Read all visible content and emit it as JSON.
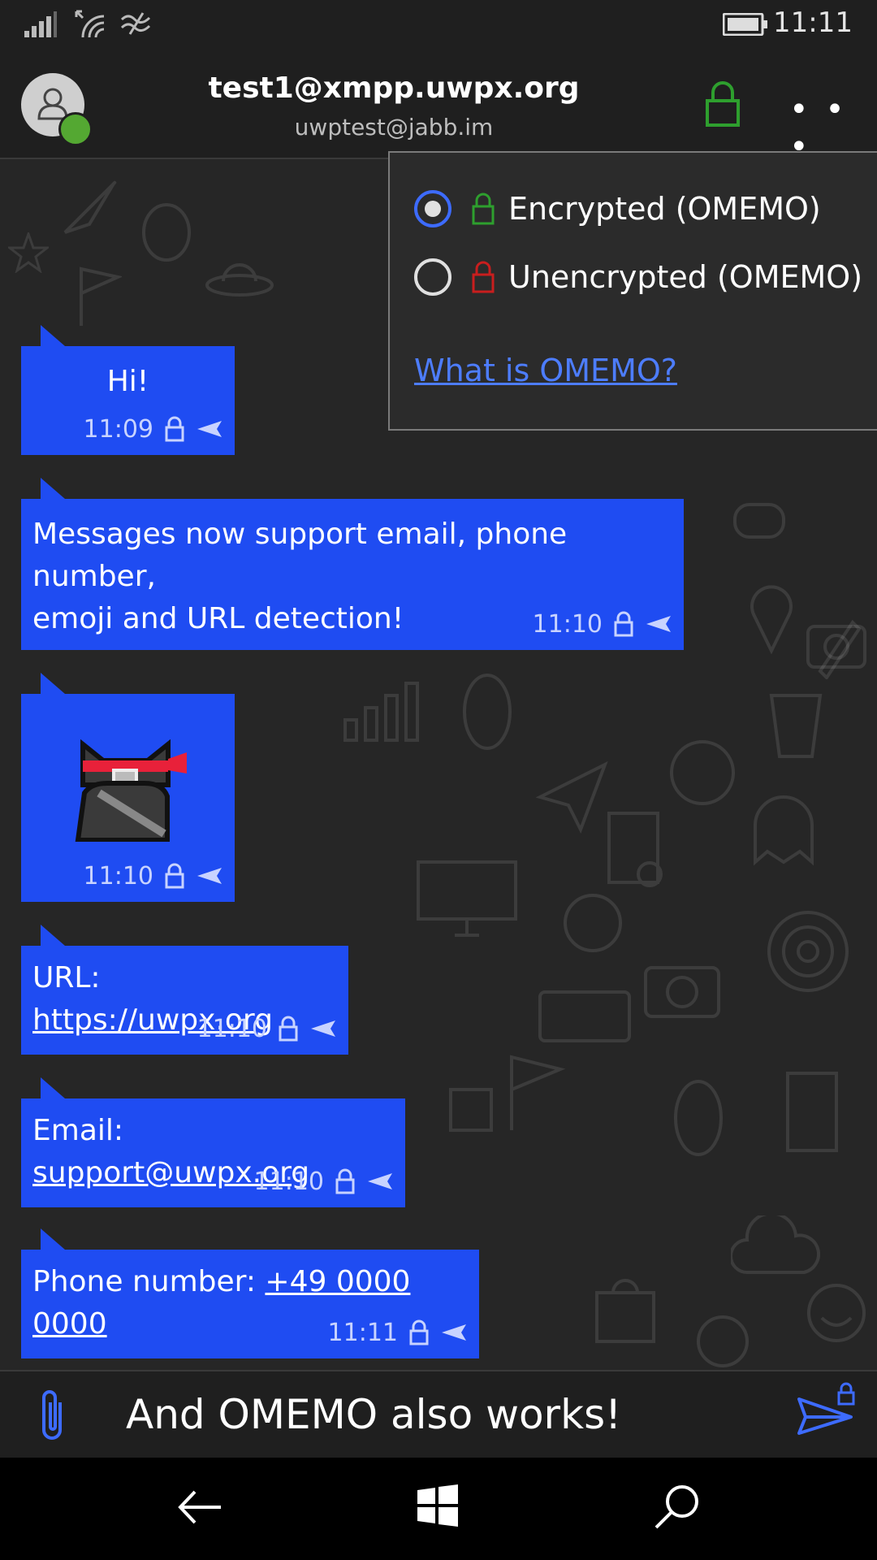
{
  "status_bar": {
    "time": "11:11",
    "icons": [
      "signal-icon",
      "wifi-icon",
      "data-sense-icon",
      "battery-icon"
    ]
  },
  "header": {
    "title": "test1@xmpp.uwpx.org",
    "subtitle": "uwptest@jabb.im",
    "more_label": "• • •",
    "lock_color": "#2e9f2e"
  },
  "encryption_menu": {
    "options": [
      {
        "label": "Encrypted (OMEMO)",
        "selected": true,
        "lock_color": "#2e9f2e"
      },
      {
        "label": "Unencrypted (OMEMO)",
        "selected": false,
        "lock_color": "#c81e1e"
      }
    ],
    "help_link": "What is OMEMO?"
  },
  "messages": [
    {
      "text": "Hi!",
      "time": "11:09"
    },
    {
      "text_line1": "Messages now support email, phone number,",
      "text_line2": "emoji and URL detection!",
      "time": "11:10"
    },
    {
      "emoji": "ninja-cat-emoji",
      "time": "11:10"
    },
    {
      "prefix": "URL: ",
      "link": "https://uwpx.org",
      "time": "11:10"
    },
    {
      "prefix": "Email: ",
      "link": "support@uwpx.org",
      "time": "11:10"
    },
    {
      "prefix": "Phone number: ",
      "link": "+49 0000 0000",
      "time": "11:11"
    }
  ],
  "composer": {
    "text": "And OMEMO also works!"
  },
  "colors": {
    "bubble": "#1f4cf2",
    "accent": "#3d6bff",
    "background": "#262626"
  }
}
